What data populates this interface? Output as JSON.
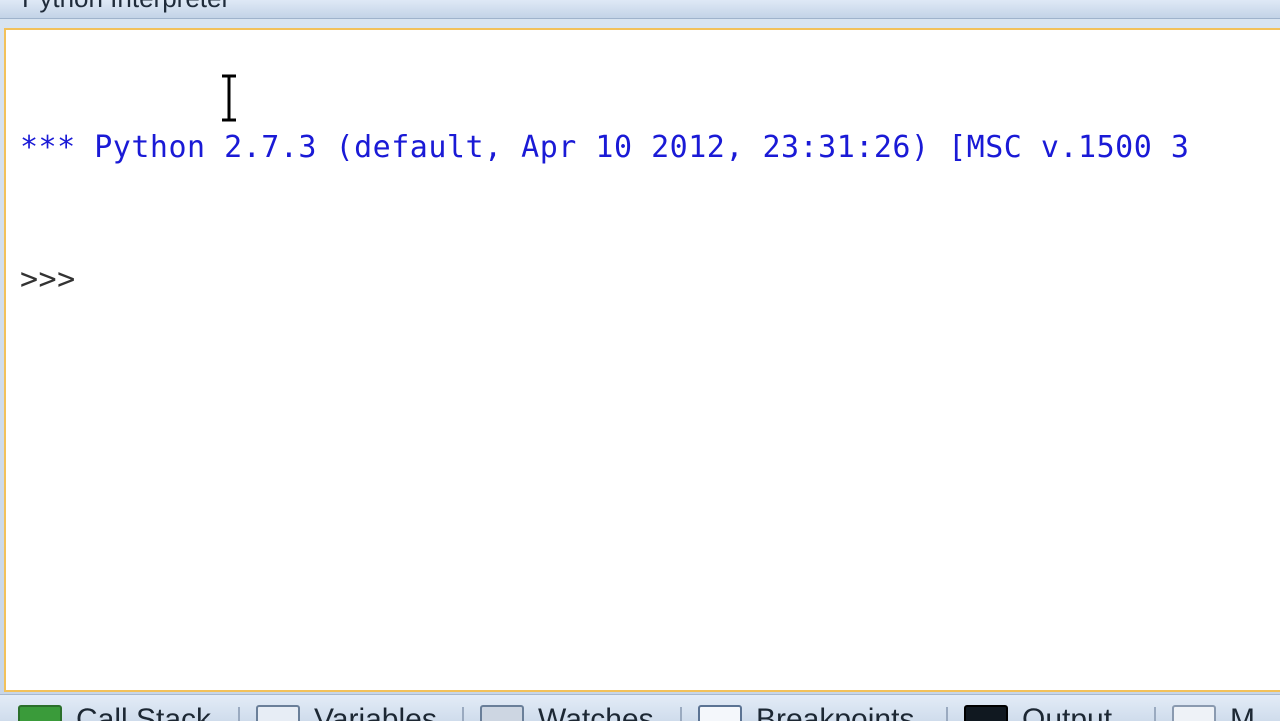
{
  "window": {
    "title": "Python Interpreter"
  },
  "console": {
    "banner": "*** Python 2.7.3 (default, Apr 10 2012, 23:31:26) [MSC v.1500 3",
    "prompt": ">>>"
  },
  "tabs": [
    {
      "label": "Call Stack",
      "icon": "call-stack-icon"
    },
    {
      "label": "Variables",
      "icon": "variables-icon"
    },
    {
      "label": "Watches",
      "icon": "watches-icon"
    },
    {
      "label": "Breakpoints",
      "icon": "breakpoints-icon"
    },
    {
      "label": "Output",
      "icon": "output-icon"
    },
    {
      "label": "M",
      "icon": "modules-icon"
    }
  ],
  "colors": {
    "banner": "#1a1ad6",
    "panel_border": "#f2c15a",
    "chrome": "#c9d8ea"
  }
}
